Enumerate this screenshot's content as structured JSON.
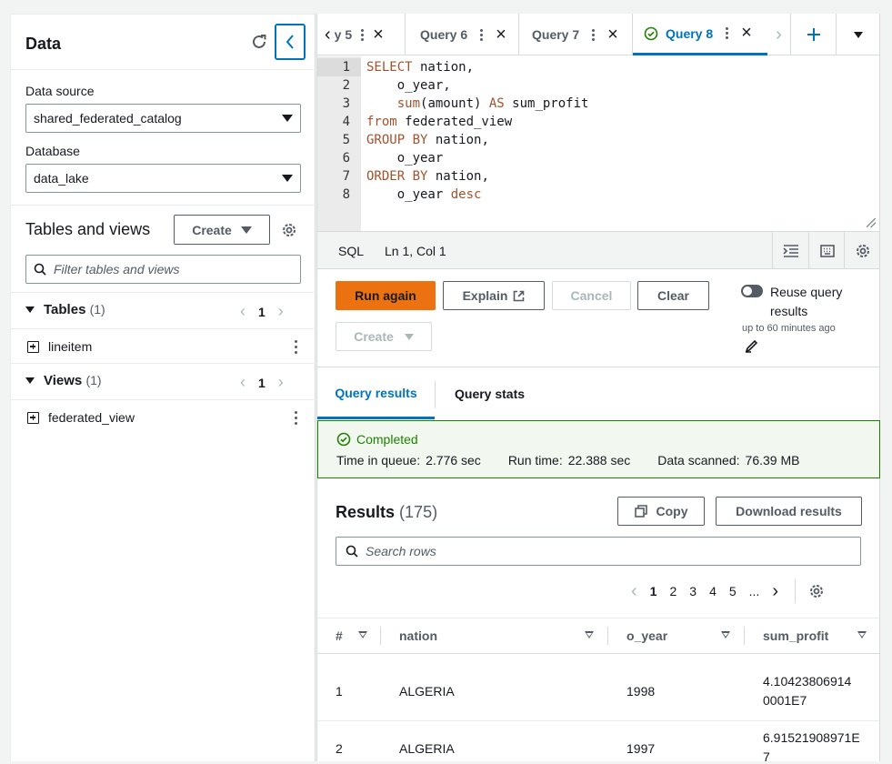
{
  "left": {
    "title": "Data",
    "data_source_label": "Data source",
    "data_source_value": "shared_federated_catalog",
    "database_label": "Database",
    "database_value": "data_lake",
    "tables_views_title": "Tables and views",
    "create_label": "Create",
    "filter_placeholder": "Filter tables and views",
    "tables": {
      "label": "Tables",
      "count": "(1)",
      "page": "1",
      "items": [
        "lineitem"
      ]
    },
    "views": {
      "label": "Views",
      "count": "(1)",
      "page": "1",
      "items": [
        "federated_view"
      ]
    }
  },
  "tabs": [
    {
      "label": "y 5"
    },
    {
      "label": "Query 6"
    },
    {
      "label": "Query 7"
    },
    {
      "label": "Query 8",
      "active": true
    }
  ],
  "editor": {
    "line_numbers": [
      "1",
      "2",
      "3",
      "4",
      "5",
      "6",
      "7",
      "8"
    ]
  },
  "statusbar": {
    "lang": "SQL",
    "position": "Ln 1, Col 1"
  },
  "actions": {
    "run_again": "Run again",
    "explain": "Explain",
    "cancel": "Cancel",
    "clear": "Clear",
    "create": "Create",
    "reuse_label": "Reuse query results",
    "reuse_sub": "up to 60 minutes ago"
  },
  "result_tabs": {
    "results": "Query results",
    "stats": "Query stats"
  },
  "status": {
    "title": "Completed",
    "queue_label": "Time in queue:",
    "queue_value": "2.776 sec",
    "run_label": "Run time:",
    "run_value": "22.388 sec",
    "scanned_label": "Data scanned:",
    "scanned_value": "76.39 MB"
  },
  "results": {
    "title": "Results",
    "count": "(175)",
    "copy": "Copy",
    "download": "Download results",
    "search_placeholder": "Search rows",
    "pages": [
      "1",
      "2",
      "3",
      "4",
      "5",
      "..."
    ],
    "columns": [
      "#",
      "nation",
      "o_year",
      "sum_profit"
    ],
    "rows": [
      {
        "n": "1",
        "nation": "ALGERIA",
        "o_year": "1998",
        "sum_profit_1": "4.10423806914",
        "sum_profit_2": "0001E7"
      },
      {
        "n": "2",
        "nation": "ALGERIA",
        "o_year": "1997",
        "sum_profit_1": "6.91521908971E",
        "sum_profit_2": "7"
      }
    ]
  },
  "colors": {
    "accent": "#0073bb",
    "primary": "#ec7211",
    "success": "#1d8102"
  }
}
